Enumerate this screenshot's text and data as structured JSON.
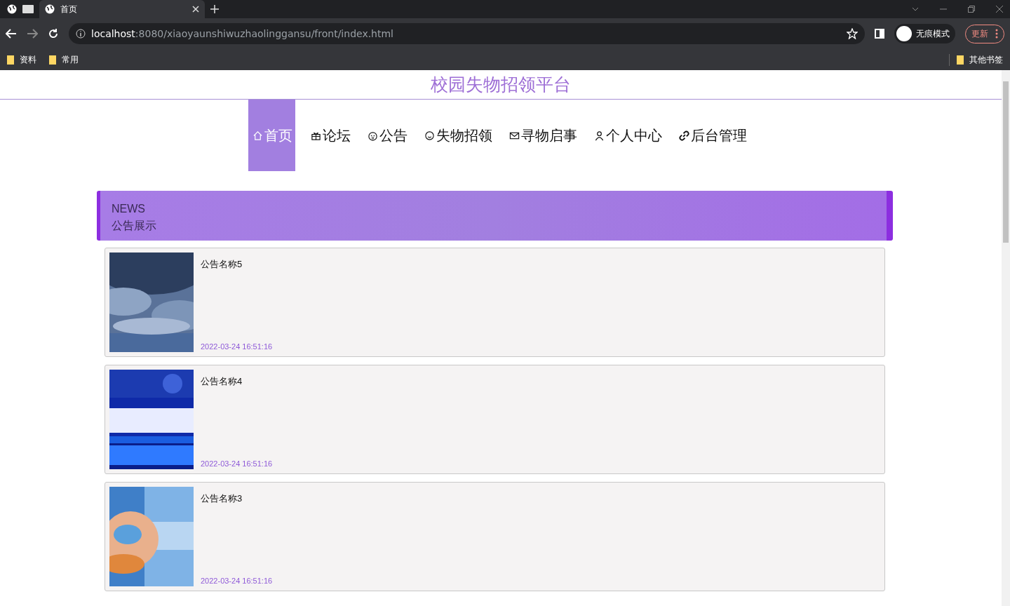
{
  "browser": {
    "tabs": [
      {
        "title": "首页",
        "selected": true
      }
    ],
    "address": {
      "host": "localhost",
      "path": ":8080/xiaoyaunshiwuzhaolinggansu/front/index.html"
    },
    "profile": "无痕模式",
    "update": "更新",
    "bookmarks": [
      "资料",
      "常用"
    ],
    "other_bookmarks": "其他书签"
  },
  "site_title": "校园失物招领平台",
  "nav": [
    {
      "label": "首页",
      "selected": true
    },
    {
      "label": "论坛",
      "selected": false
    },
    {
      "label": "公告",
      "selected": false
    },
    {
      "label": "失物招领",
      "selected": false
    },
    {
      "label": "寻物启事",
      "selected": false
    },
    {
      "label": "个人中心",
      "selected": false
    },
    {
      "label": "后台管理",
      "selected": false
    }
  ],
  "section": {
    "heading": "NEWS",
    "subheading": "公告展示"
  },
  "news": [
    {
      "kind": "picture",
      "title": "公告名称5",
      "date": "2022-03-24 16:51:16"
    },
    {
      "kind": "picture",
      "title": "公告名称4",
      "date": "2022-03-24 16:51:16"
    },
    {
      "kind": "picture",
      "title": "公告名称3",
      "date": "2022-03-24 16:51:16"
    }
  ]
}
